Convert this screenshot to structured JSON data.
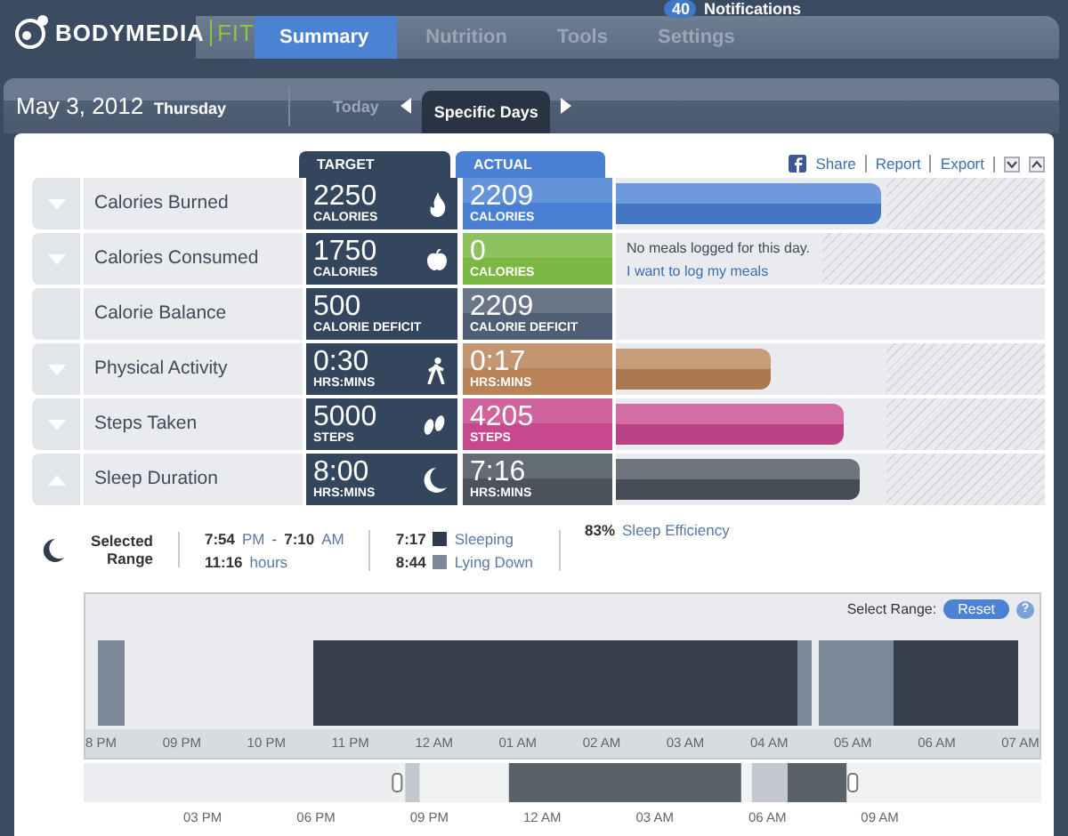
{
  "top_bar": {
    "notifications_count": "40",
    "notifications_label": "Notifications"
  },
  "logo": {
    "brand": "BODYMEDIA",
    "product": "FIT"
  },
  "nav": [
    {
      "label": "Summary",
      "selected": true
    },
    {
      "label": "Nutrition",
      "selected": false
    },
    {
      "label": "Tools",
      "selected": false
    },
    {
      "label": "Settings",
      "selected": false
    }
  ],
  "date_bar": {
    "date": "May 3, 2012",
    "weekday": "Thursday",
    "modes": [
      {
        "label": "Today",
        "selected": false
      },
      {
        "label": "Specific Days",
        "selected": true
      }
    ]
  },
  "columns": {
    "target": "TARGET",
    "actual": "ACTUAL"
  },
  "actions": [
    "Share",
    "Report",
    "Export"
  ],
  "metrics": [
    {
      "name": "Calories Burned",
      "expanded": false,
      "target": "2250",
      "target_unit": "CALORIES",
      "actual": "2209",
      "actual_unit": "CALORIES",
      "color": "#4a80d4",
      "kind": "bar",
      "level": 0.62
    },
    {
      "name": "Calories Consumed",
      "expanded": false,
      "target": "1750",
      "target_unit": "CALORIES",
      "actual": "0",
      "actual_unit": "CALORIES",
      "color": "#7bb843",
      "kind": "message",
      "message": "No meals logged for this day.",
      "link": "I want to log my meals"
    },
    {
      "name": "Calorie Balance",
      "target": "500",
      "target_unit": "CALORIE DEFICIT",
      "actual": "2209",
      "actual_unit": "CALORIE DEFICIT",
      "color": "#4f5e74",
      "kind": "empty"
    },
    {
      "name": "Physical Activity",
      "expanded": false,
      "target": "0:30",
      "target_unit": "HRS:MINS",
      "actual": "0:17",
      "actual_unit": "HRS:MINS",
      "color": "#b98357",
      "kind": "bar",
      "level": 0.36
    },
    {
      "name": "Steps Taken",
      "expanded": false,
      "target": "5000",
      "target_unit": "STEPS",
      "actual": "4205",
      "actual_unit": "STEPS",
      "color": "#c8488e",
      "kind": "bar",
      "level": 0.53
    },
    {
      "name": "Sleep Duration",
      "expanded": true,
      "target": "8:00",
      "target_unit": "HRS:MINS",
      "actual": "7:16",
      "actual_unit": "HRS:MINS",
      "color": "#4b525c",
      "kind": "bar",
      "level": 0.57
    }
  ],
  "sleep_summary": {
    "title": "Selected Range",
    "start": "7:54",
    "start_period": "PM",
    "separator": "-",
    "end": "7:10",
    "end_period": "AM",
    "duration": "11:16",
    "duration_unit": "hours",
    "states": [
      {
        "time": "7:17",
        "label": "Sleeping",
        "color": "#2f3a4a"
      },
      {
        "time": "8:44",
        "label": "Lying Down",
        "color": "#7d8899"
      }
    ],
    "efficiency": "83%",
    "efficiency_label": "Sleep Efficiency"
  },
  "timeline": {
    "select_label": "Select Range:",
    "reset": "Reset",
    "help": "?",
    "axis": [
      "8 PM",
      "09 PM",
      "10 PM",
      "11 PM",
      "12 AM",
      "01 AM",
      "02 AM",
      "03 AM",
      "04 AM",
      "05 AM",
      "06 AM",
      "07 AM"
    ],
    "overview_axis": [
      "03 PM",
      "06 PM",
      "09 PM",
      "12 AM",
      "03 AM",
      "06 AM",
      "09 AM"
    ]
  }
}
